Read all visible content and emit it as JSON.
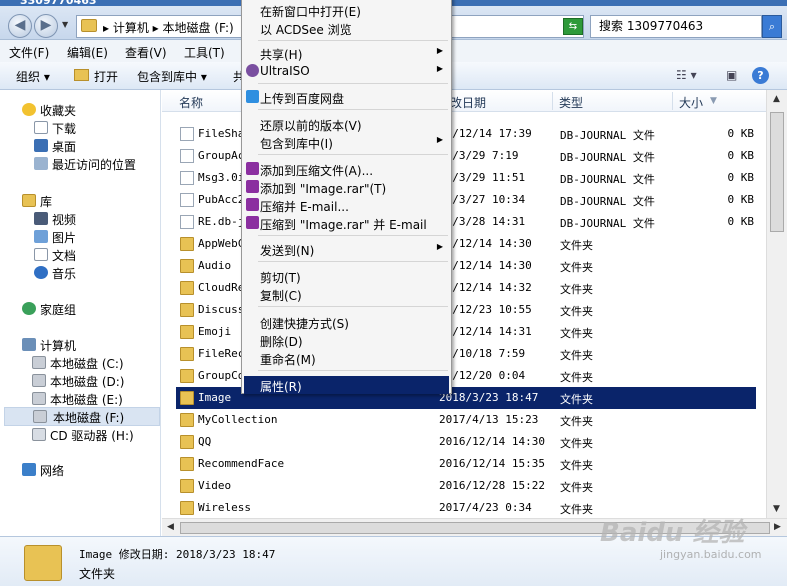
{
  "window": {
    "title": "3309770463"
  },
  "address": {
    "breadcrumb": "▸ 计算机 ▸ 本地磁盘 (F:)",
    "search_placeholder": "搜索 1309770463"
  },
  "menubar": {
    "file": "文件(F)",
    "edit": "编辑(E)",
    "view": "查看(V)",
    "tools": "工具(T)"
  },
  "toolbar": {
    "organize": "组织 ▾",
    "open": "打开",
    "include_in_library": "包含到库中 ▾",
    "share": "共"
  },
  "sidebar": {
    "favorites": "收藏夹",
    "downloads": "下载",
    "desktop": "桌面",
    "recent": "最近访问的位置",
    "libraries": "库",
    "videos": "视频",
    "pictures": "图片",
    "documents": "文档",
    "music": "音乐",
    "homegroup": "家庭组",
    "computer": "计算机",
    "drive_c": "本地磁盘 (C:)",
    "drive_d": "本地磁盘 (D:)",
    "drive_e": "本地磁盘 (E:)",
    "drive_f": "本地磁盘 (F:)",
    "drive_h": "CD 驱动器 (H:)",
    "network": "网络"
  },
  "columns": {
    "name": "名称",
    "date": "改日期",
    "type": "类型",
    "size": "大小"
  },
  "files": [
    {
      "name": "FileSha",
      "date": "16/12/14 17:39",
      "type": "DB-JOURNAL 文件",
      "size": "0 KB",
      "kind": "file"
    },
    {
      "name": "GroupAc",
      "date": "18/3/29 7:19",
      "type": "DB-JOURNAL 文件",
      "size": "0 KB",
      "kind": "file"
    },
    {
      "name": "Msg3.0i",
      "date": "18/3/29 11:51",
      "type": "DB-JOURNAL 文件",
      "size": "0 KB",
      "kind": "file"
    },
    {
      "name": "PubAcc2",
      "date": "18/3/27 10:34",
      "type": "DB-JOURNAL 文件",
      "size": "0 KB",
      "kind": "file"
    },
    {
      "name": "RE.db-j",
      "date": "18/3/28 14:31",
      "type": "DB-JOURNAL 文件",
      "size": "0 KB",
      "kind": "file"
    },
    {
      "name": "AppWebC",
      "date": "16/12/14 14:30",
      "type": "文件夹",
      "size": "",
      "kind": "folder"
    },
    {
      "name": "Audio",
      "date": "16/12/14 14:30",
      "type": "文件夹",
      "size": "",
      "kind": "folder"
    },
    {
      "name": "CloudRe",
      "date": "16/12/14 14:32",
      "type": "文件夹",
      "size": "",
      "kind": "folder"
    },
    {
      "name": "Discuss",
      "date": "16/12/23 10:55",
      "type": "文件夹",
      "size": "",
      "kind": "folder"
    },
    {
      "name": "Emoji",
      "date": "16/12/14 14:31",
      "type": "文件夹",
      "size": "",
      "kind": "folder"
    },
    {
      "name": "FileRec",
      "date": "17/10/18 7:59",
      "type": "文件夹",
      "size": "",
      "kind": "folder"
    },
    {
      "name": "GroupCo",
      "date": "16/12/20 0:04",
      "type": "文件夹",
      "size": "",
      "kind": "folder"
    },
    {
      "name": "Image",
      "date": "2018/3/23 18:47",
      "type": "文件夹",
      "size": "",
      "kind": "folder",
      "selected": true
    },
    {
      "name": "MyCollection",
      "date": "2017/4/13 15:23",
      "type": "文件夹",
      "size": "",
      "kind": "folder"
    },
    {
      "name": "QQ",
      "date": "2016/12/14 14:30",
      "type": "文件夹",
      "size": "",
      "kind": "folder"
    },
    {
      "name": "RecommendFace",
      "date": "2016/12/14 15:35",
      "type": "文件夹",
      "size": "",
      "kind": "folder"
    },
    {
      "name": "Video",
      "date": "2016/12/28 15:22",
      "type": "文件夹",
      "size": "",
      "kind": "folder"
    },
    {
      "name": "Wireless",
      "date": "2017/4/23 0:34",
      "type": "文件夹",
      "size": "",
      "kind": "folder"
    }
  ],
  "context_menu": {
    "open_new_window": "在新窗口中打开(E)",
    "browse_acdsee": "以 ACDSee 浏览",
    "share": "共享(H)",
    "ultraiso": "UltraISO",
    "upload_baidu": "上传到百度网盘",
    "restore_previous": "还原以前的版本(V)",
    "include_library": "包含到库中(I)",
    "add_archive": "添加到压缩文件(A)...",
    "add_image_rar": "添加到 \"Image.rar\"(T)",
    "compress_email": "压缩并 E-mail...",
    "compress_image_email": "压缩到 \"Image.rar\" 并 E-mail",
    "send_to": "发送到(N)",
    "cut": "剪切(T)",
    "copy": "复制(C)",
    "create_shortcut": "创建快捷方式(S)",
    "delete": "删除(D)",
    "rename": "重命名(M)",
    "properties": "属性(R)"
  },
  "details": {
    "name_line": "Image 修改日期: 2018/3/23 18:47",
    "type": "文件夹"
  },
  "watermark": {
    "main": "Baidu 经验",
    "sub": "jingyan.baidu.com"
  }
}
